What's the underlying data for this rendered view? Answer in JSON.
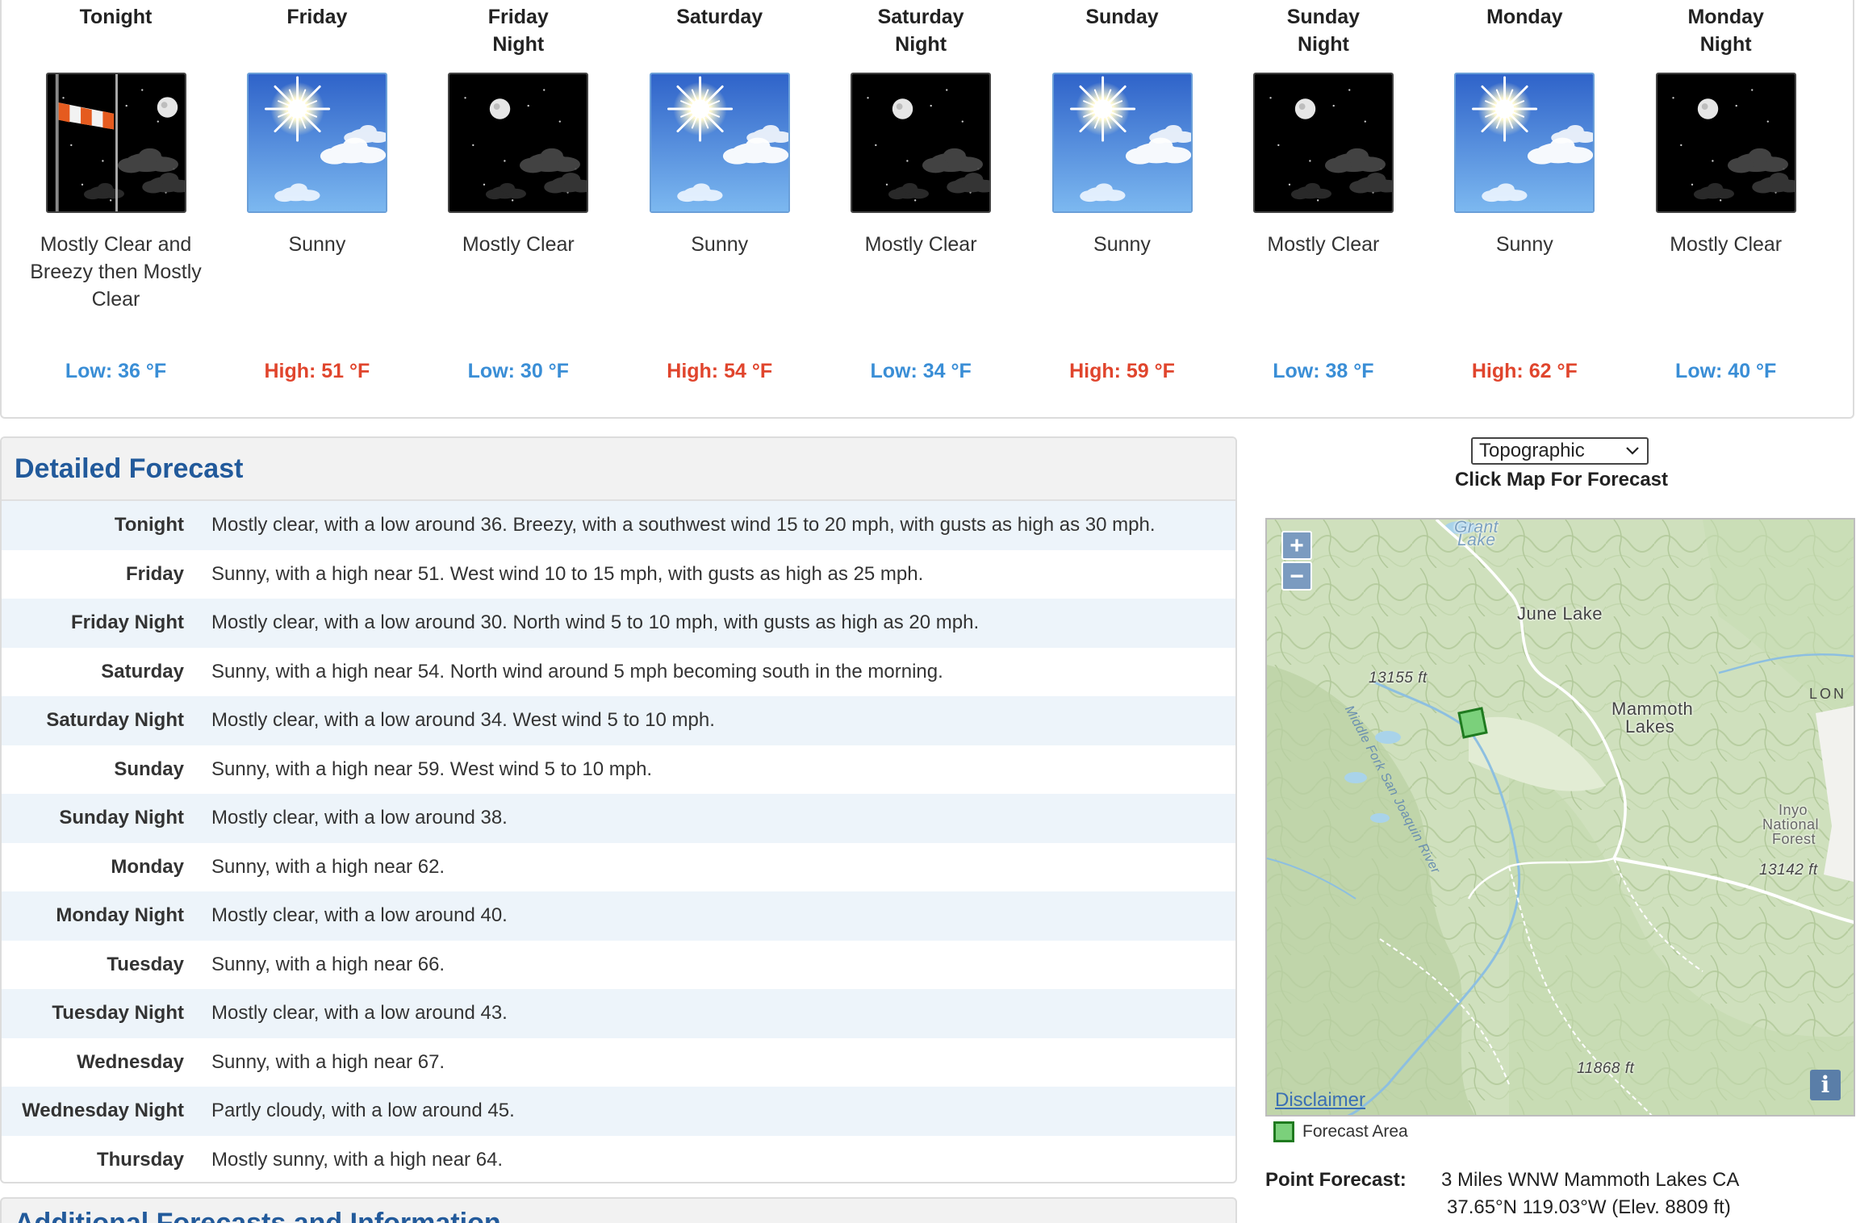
{
  "periods": [
    {
      "name_line1": "Tonight",
      "name_line2": "",
      "icon": "night-wind-icon",
      "short": "Mostly Clear and Breezy then Mostly Clear",
      "temp": "Low: 36 °F",
      "kind": "low"
    },
    {
      "name_line1": "Friday",
      "name_line2": "",
      "icon": "sunny-icon",
      "short": "Sunny",
      "temp": "High: 51 °F",
      "kind": "high"
    },
    {
      "name_line1": "Friday",
      "name_line2": "Night",
      "icon": "night-clear-icon",
      "short": "Mostly Clear",
      "temp": "Low: 30 °F",
      "kind": "low"
    },
    {
      "name_line1": "Saturday",
      "name_line2": "",
      "icon": "sunny-icon",
      "short": "Sunny",
      "temp": "High: 54 °F",
      "kind": "high"
    },
    {
      "name_line1": "Saturday",
      "name_line2": "Night",
      "icon": "night-clear-icon",
      "short": "Mostly Clear",
      "temp": "Low: 34 °F",
      "kind": "low"
    },
    {
      "name_line1": "Sunday",
      "name_line2": "",
      "icon": "sunny-icon",
      "short": "Sunny",
      "temp": "High: 59 °F",
      "kind": "high"
    },
    {
      "name_line1": "Sunday",
      "name_line2": "Night",
      "icon": "night-clear-icon",
      "short": "Mostly Clear",
      "temp": "Low: 38 °F",
      "kind": "low"
    },
    {
      "name_line1": "Monday",
      "name_line2": "",
      "icon": "sunny-icon",
      "short": "Sunny",
      "temp": "High: 62 °F",
      "kind": "high"
    },
    {
      "name_line1": "Monday",
      "name_line2": "Night",
      "icon": "night-clear-icon",
      "short": "Mostly Clear",
      "temp": "Low: 40 °F",
      "kind": "low"
    }
  ],
  "colors": {
    "low": "#3a8ed6",
    "high": "#e0452d",
    "heading": "#225a9b",
    "row_alt": "#edf4fa"
  },
  "detailed": {
    "title": "Detailed Forecast",
    "rows": [
      {
        "label": "Tonight",
        "text": "Mostly clear, with a low around 36. Breezy, with a southwest wind 15 to 20 mph, with gusts as high as 30 mph."
      },
      {
        "label": "Friday",
        "text": "Sunny, with a high near 51. West wind 10 to 15 mph, with gusts as high as 25 mph."
      },
      {
        "label": "Friday Night",
        "text": "Mostly clear, with a low around 30. North wind 5 to 10 mph, with gusts as high as 20 mph."
      },
      {
        "label": "Saturday",
        "text": "Sunny, with a high near 54. North wind around 5 mph becoming south in the morning."
      },
      {
        "label": "Saturday Night",
        "text": "Mostly clear, with a low around 34. West wind 5 to 10 mph."
      },
      {
        "label": "Sunday",
        "text": "Sunny, with a high near 59. West wind 5 to 10 mph."
      },
      {
        "label": "Sunday Night",
        "text": "Mostly clear, with a low around 38."
      },
      {
        "label": "Monday",
        "text": "Sunny, with a high near 62."
      },
      {
        "label": "Monday Night",
        "text": "Mostly clear, with a low around 40."
      },
      {
        "label": "Tuesday",
        "text": "Sunny, with a high near 66."
      },
      {
        "label": "Tuesday Night",
        "text": "Mostly clear, with a low around 43."
      },
      {
        "label": "Wednesday",
        "text": "Sunny, with a high near 67."
      },
      {
        "label": "Wednesday Night",
        "text": "Partly cloudy, with a low around 45."
      },
      {
        "label": "Thursday",
        "text": "Mostly sunny, with a high near 64."
      }
    ]
  },
  "additional": {
    "title": "Additional Forecasts and Information"
  },
  "map": {
    "select_value": "Topographic",
    "caption": "Click Map For Forecast",
    "zoom_in": "+",
    "zoom_out": "−",
    "info": "i",
    "disclaimer": "Disclaimer",
    "labels": {
      "grant_lake_1": "Grant",
      "grant_lake_2": "Lake",
      "june_lake": "June Lake",
      "river": "Middle Fork San Joaquin River",
      "elev_13155": "13155 ft",
      "mammoth_1": "Mammoth",
      "mammoth_2": "Lakes",
      "lon": "LON",
      "inyo_1": "Inyo",
      "inyo_2": "National",
      "inyo_3": "Forest",
      "elev_13142": "13142 ft",
      "elev_11868": "11868 ft"
    },
    "legend": "Forecast Area"
  },
  "point_forecast": {
    "label": "Point Forecast:",
    "location": "3 Miles WNW Mammoth Lakes CA",
    "coords": "37.65°N 119.03°W (Elev. 8809 ft)"
  }
}
